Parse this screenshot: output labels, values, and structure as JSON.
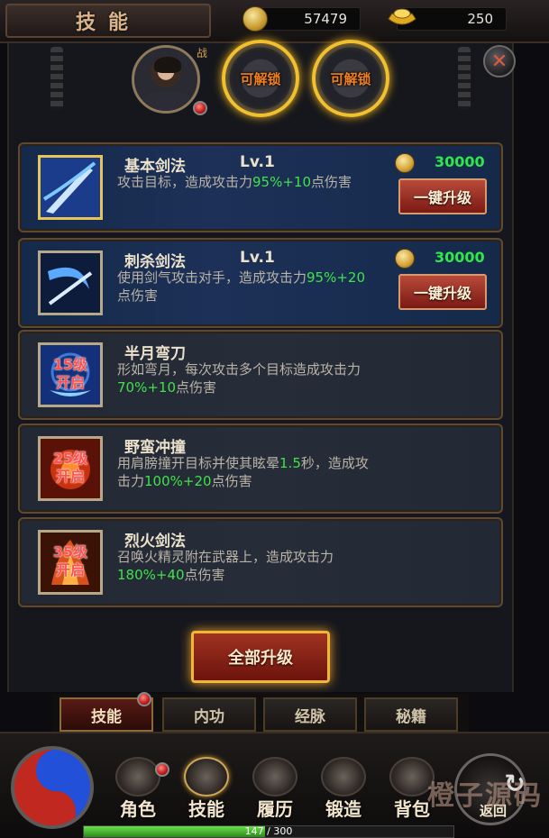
{
  "header": {
    "title": "技能",
    "gold": "57479",
    "ingot": "250"
  },
  "hero": {
    "portrait_tag": "战",
    "unlock_slots": [
      "可解锁",
      "可解锁"
    ]
  },
  "skills": [
    {
      "name": "基本剑法",
      "level": "Lv.1",
      "desc_a": "攻击目标，造成攻击力",
      "desc_g1": "95%+10",
      "desc_b": "点伤害",
      "cost": "30000",
      "button": "一键升级",
      "lock": ""
    },
    {
      "name": "刺杀剑法",
      "level": "Lv.1",
      "desc_a": "使用剑气攻击对手，造成攻击力",
      "desc_g1": "95%+20",
      "desc_b": "点伤害",
      "cost": "30000",
      "button": "一键升级",
      "lock": ""
    },
    {
      "name": "半月弯刀",
      "level": "",
      "desc_a": "形如弯月，每次攻击多个目标造成攻击力",
      "desc_g1": "70%+10",
      "desc_b": "点伤害",
      "cost": "",
      "button": "",
      "lock_l1": "15级",
      "lock_l2": "开启"
    },
    {
      "name": "野蛮冲撞",
      "level": "",
      "desc_a": "用肩膀撞开目标并使其眩晕",
      "desc_g1": "1.5",
      "desc_mid": "秒，造成攻击力",
      "desc_g2": "100%+20",
      "desc_b": "点伤害",
      "cost": "",
      "button": "",
      "lock_l1": "25级",
      "lock_l2": "开启"
    },
    {
      "name": "烈火剑法",
      "level": "",
      "desc_a": "召唤火精灵附在武器上，造成攻击力",
      "desc_g1": "180%+40",
      "desc_b": "点伤害",
      "cost": "",
      "button": "",
      "lock_l1": "35级",
      "lock_l2": "开启"
    }
  ],
  "all_upgrade_label": "全部升级",
  "tabs": [
    "技能",
    "内功",
    "经脉",
    "秘籍"
  ],
  "nav": [
    "角色",
    "技能",
    "履历",
    "锻造",
    "背包"
  ],
  "back_label": "返回",
  "watermark": "橙子源码",
  "exp": {
    "text": "147 / 300",
    "fraction": 0.49
  },
  "colors": {
    "accent_green": "#3fe24a",
    "button_red": "#8a2418",
    "gold_glow": "#f0c030"
  }
}
